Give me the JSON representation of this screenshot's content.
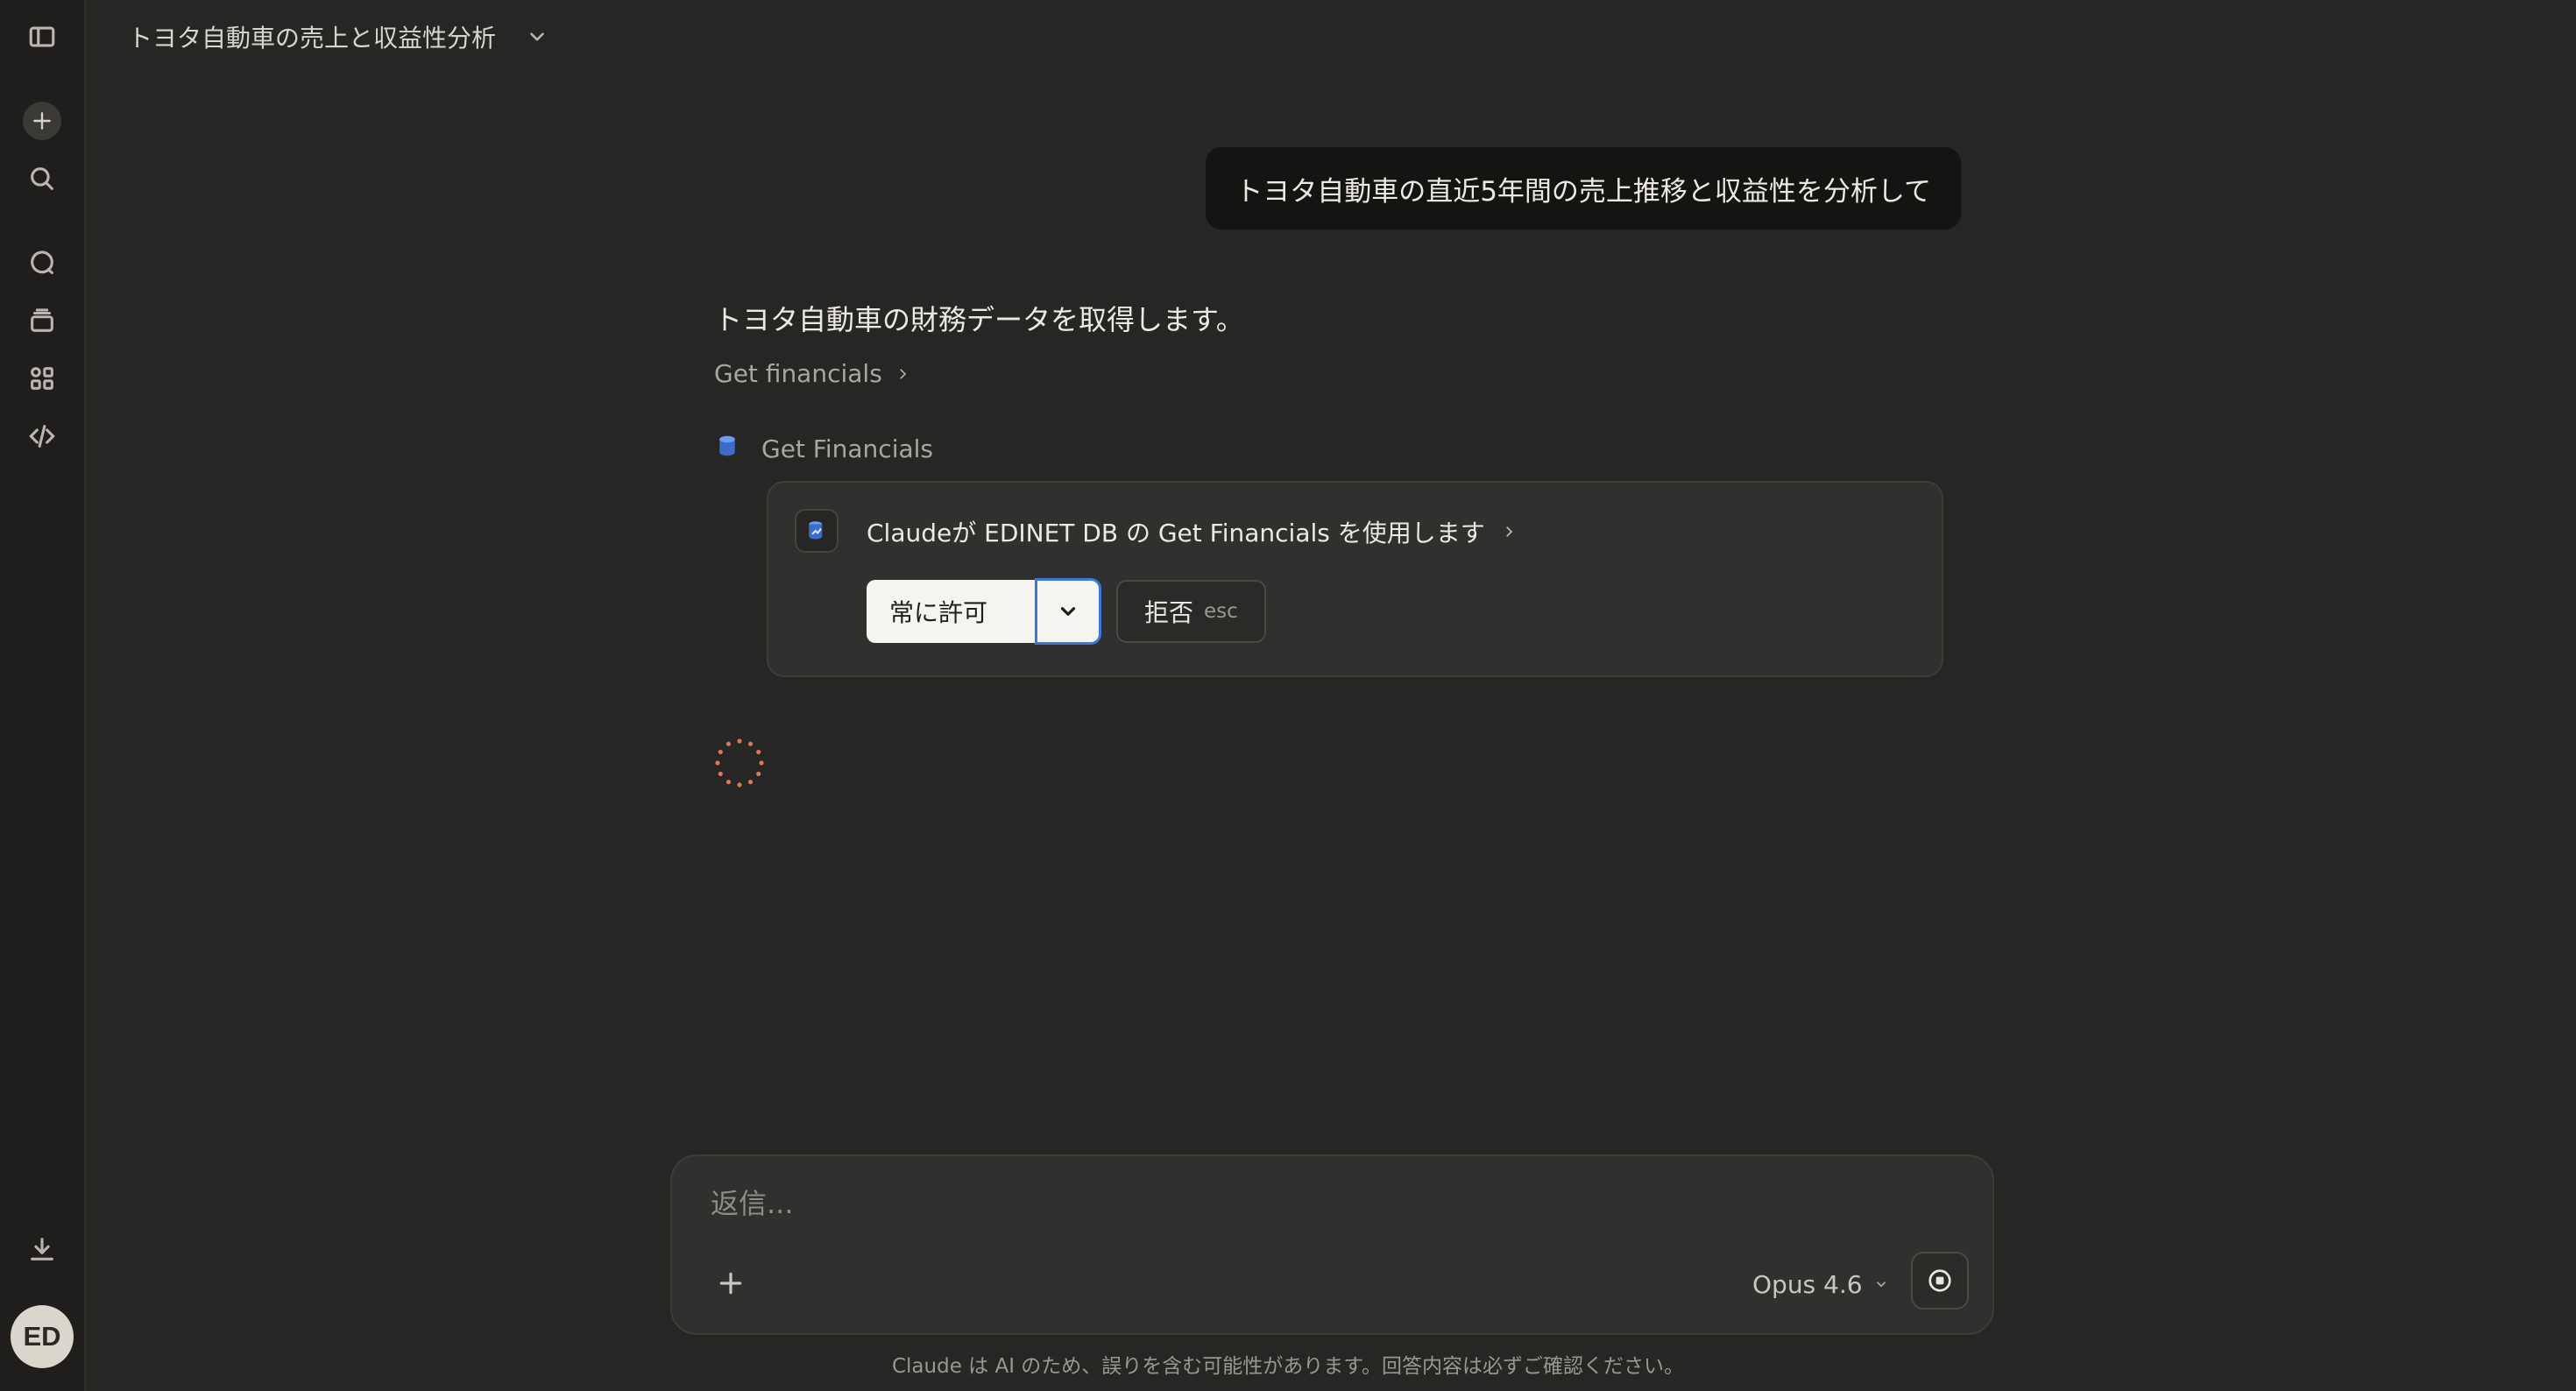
{
  "sidebar": {
    "items": [
      {
        "name": "sidebar-toggle",
        "icon": "sidebar-panel-icon"
      },
      {
        "name": "new-chat",
        "icon": "plus-icon"
      },
      {
        "name": "search",
        "icon": "search-icon"
      },
      {
        "name": "chats",
        "icon": "chat-bubble-icon"
      },
      {
        "name": "projects",
        "icon": "folder-stack-icon"
      },
      {
        "name": "artifacts",
        "icon": "grid-shapes-icon"
      },
      {
        "name": "code",
        "icon": "code-icon"
      }
    ],
    "download_icon": "download-icon",
    "avatar_initials": "ED"
  },
  "header": {
    "title": "トヨタ自動車の売上と収益性分析"
  },
  "conversation": {
    "user_message": "トヨタ自動車の直近5年間の売上推移と収益性を分析して",
    "assistant_text": "トヨタ自動車の財務データを取得します。",
    "tool_link_label": "Get financials",
    "tool_name": "Get Financials",
    "permission": {
      "title": "Claudeが EDINET DB の Get Financials を使用します",
      "allow_label": "常に許可",
      "deny_label": "拒否",
      "deny_shortcut": "esc"
    }
  },
  "composer": {
    "placeholder": "返信...",
    "model_label": "Opus 4.6"
  },
  "footer": {
    "disclaimer": "Claude は AI のため、誤りを含む可能性があります。回答内容は必ずご確認ください。"
  },
  "colors": {
    "background": "#262624",
    "sidebar": "#1f1e1d",
    "accent_focus": "#3b78d8",
    "spinner": "#d97757",
    "tool_icon": "#4a7fe0"
  }
}
